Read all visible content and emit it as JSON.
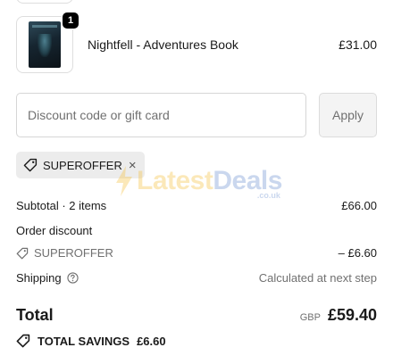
{
  "cart": {
    "item": {
      "name": "Nightfell - Adventures Book",
      "price": "£31.00",
      "quantity": "1",
      "image": "book-cover"
    }
  },
  "discount": {
    "placeholder": "Discount code or gift card",
    "apply_label": "Apply",
    "applied_code": "SUPEROFFER",
    "remove_icon": "×"
  },
  "watermark": {
    "brand_prefix": "Latest",
    "brand_suffix": "Deals",
    "domain": ".co.uk"
  },
  "summary": {
    "subtotal_label": "Subtotal · 2 items",
    "subtotal_value": "£66.00",
    "order_discount_label": "Order discount",
    "discount_code": "SUPEROFFER",
    "discount_value": "– £6.60",
    "shipping_label": "Shipping",
    "shipping_value": "Calculated at next step",
    "total_label": "Total",
    "currency": "GBP",
    "total_value": "£59.40",
    "savings_label": "TOTAL SAVINGS",
    "savings_value": "£6.60"
  },
  "colors": {
    "text": "#1a1a1a",
    "muted": "#707070",
    "chip_bg": "#ececec",
    "watermark_blue": "#6a8fcf",
    "watermark_yellow": "#f5bf3a"
  }
}
